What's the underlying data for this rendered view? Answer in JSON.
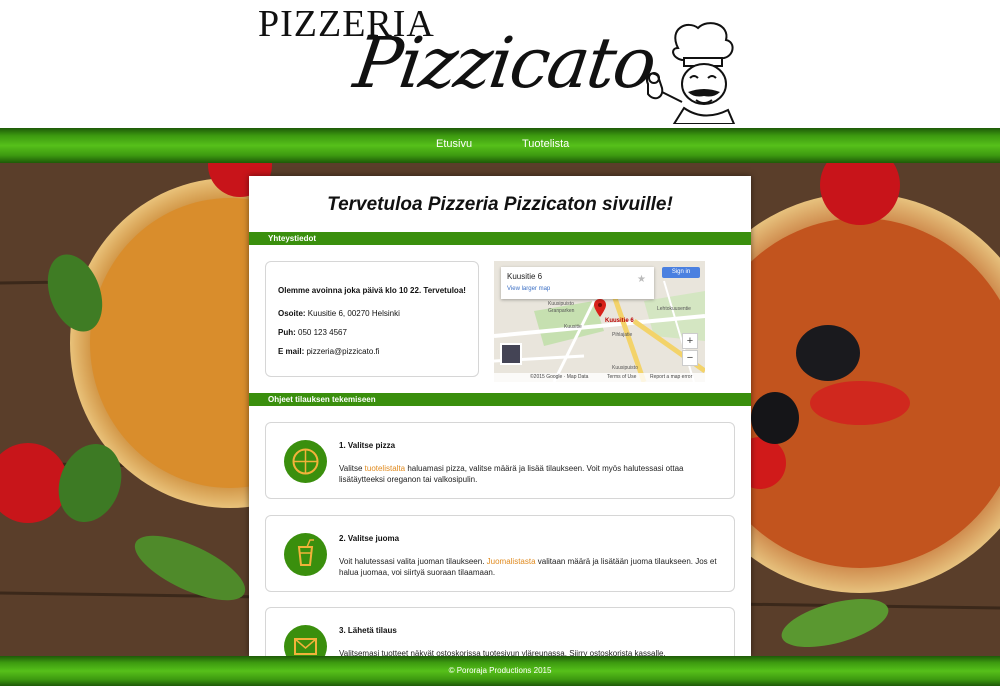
{
  "header": {
    "logo_top": "PIZZERIA",
    "logo_script": "Pizzicato"
  },
  "nav": {
    "items": [
      {
        "label": "Etusivu"
      },
      {
        "label": "Tuotelista"
      }
    ]
  },
  "main": {
    "title": "Tervetuloa Pizzeria Pizzicaton sivuille!",
    "contact": {
      "section_label": "Yhteystiedot",
      "intro": "Olemme avoinna joka päivä klo 10 22. Tervetuloa!",
      "address_label": "Osoite:",
      "address_value": "Kuusitie 6, 00270 Helsinki",
      "phone_label": "Puh:",
      "phone_value": "050 123 4567",
      "email_label": "E mail:",
      "email_value": "pizzeria@pizzicato.fi"
    },
    "map": {
      "place_title": "Kuusitie 6",
      "larger_map_link": "View larger map",
      "sign_in": "Sign in",
      "pin_label": "Kuusitie 6",
      "zoom_in": "+",
      "zoom_out": "−",
      "street_labels": [
        "Kuusipuisto",
        "Granparken",
        "Kuusitie",
        "Pihlajatie",
        "Lehtokuusentie",
        "Kuusipuisto"
      ],
      "footer_copyright": "©2015 Google · Map Data",
      "footer_terms": "Terms of Use",
      "footer_report": "Report a map error"
    },
    "instructions": {
      "section_label": "Ohjeet tilauksen tekemiseen",
      "steps": [
        {
          "title": "1. Valitse pizza",
          "text_before": "Valitse ",
          "link": "tuotelistalta",
          "text_after": " haluamasi pizza, valitse määrä ja lisää tilaukseen. Voit myös halutessasi ottaa lisätäytteeksi oreganon tai valkosipulin.",
          "icon": "pizza-icon"
        },
        {
          "title": "2. Valitse juoma",
          "text_before": "Voit halutessasi valita juoman tilaukseen. ",
          "link": "Juomalistasta",
          "text_after": " valitaan määrä ja lisätään juoma tilaukseen. Jos et halua juomaa, voi siirtyä suoraan tilaamaan.",
          "icon": "drink-icon"
        },
        {
          "title": "3. Lähetä tilaus",
          "text_before": "Valitsemasi tuotteet näkyät ostoskorissa tuotesivun yläreunassa. Siirry ostoskorista kassalle.",
          "link": "",
          "text_after": "",
          "icon": "envelope-icon"
        }
      ]
    }
  },
  "footer": {
    "text": "© Pororaja Productions 2015"
  },
  "colors": {
    "accent_green": "#3a8f0d",
    "link_orange": "#e08a1e"
  }
}
